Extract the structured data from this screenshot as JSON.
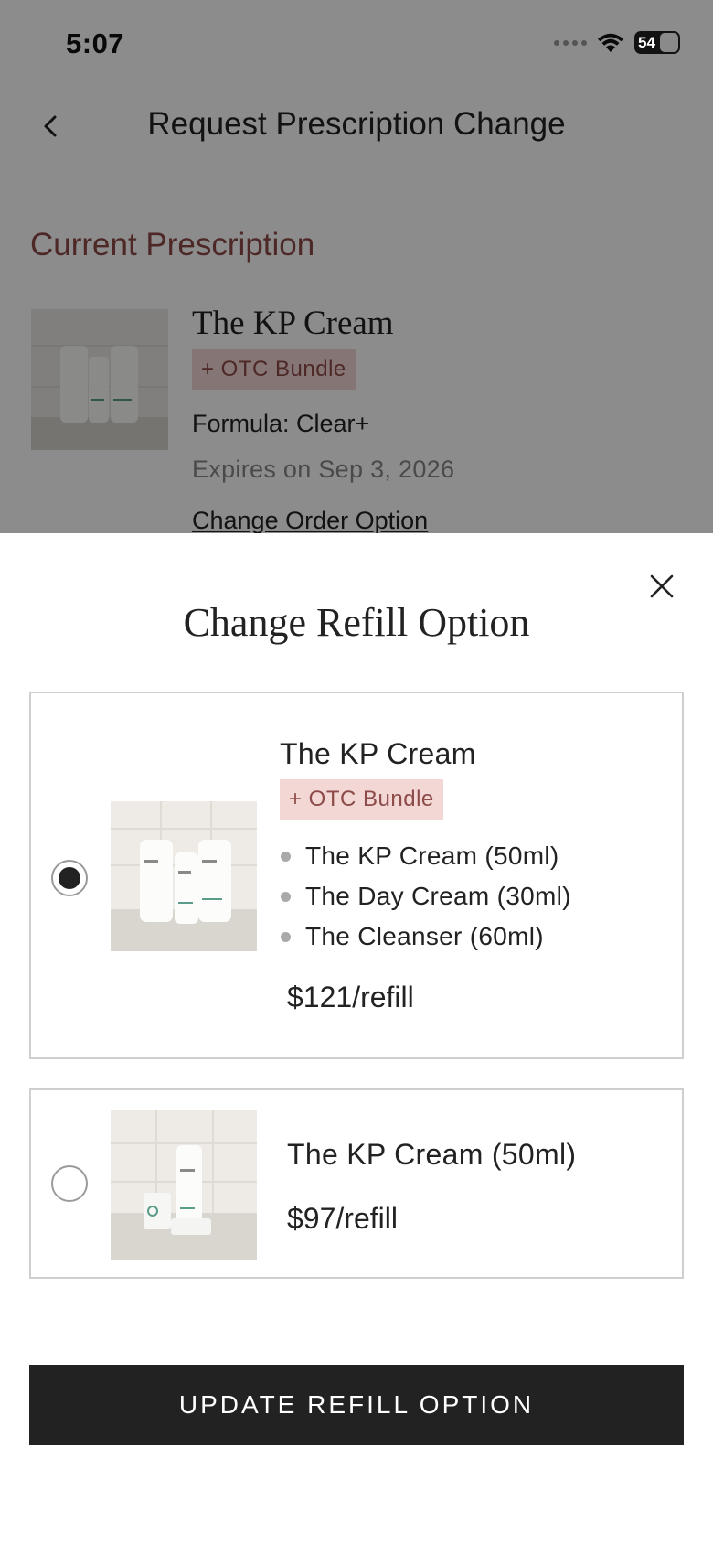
{
  "status_bar": {
    "time": "5:07",
    "battery": "54"
  },
  "nav": {
    "title": "Request Prescription Change",
    "back_icon": "chevron-left-icon"
  },
  "current_prescription": {
    "section_title": "Current Prescription",
    "product_name": "The KP Cream",
    "badge": "+ OTC Bundle",
    "formula": "Formula: Clear+",
    "expires": "Expires on Sep 3, 2026",
    "change_link": "Change Order Option"
  },
  "sheet": {
    "title": "Change Refill Option",
    "close_icon": "close-icon",
    "options": [
      {
        "selected": true,
        "name": "The KP Cream",
        "badge": "+ OTC Bundle",
        "items": [
          "The KP Cream (50ml)",
          "The Day Cream (30ml)",
          "The Cleanser (60ml)"
        ],
        "price": "$121/refill"
      },
      {
        "selected": false,
        "name": "The KP Cream (50ml)",
        "price": "$97/refill"
      }
    ],
    "update_button": "UPDATE REFILL OPTION"
  },
  "colors": {
    "accent": "#8c4a48",
    "badge_bg": "#f2d7d5",
    "button_bg": "#222222"
  }
}
